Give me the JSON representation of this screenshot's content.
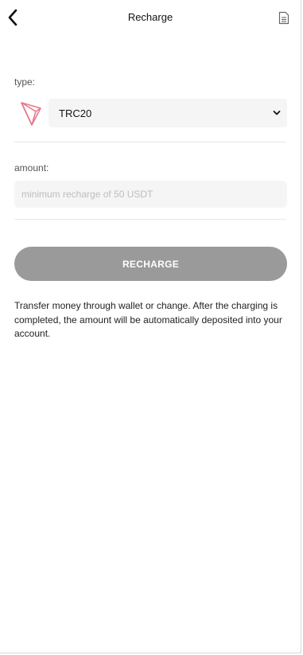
{
  "header": {
    "title": "Recharge"
  },
  "form": {
    "type_label": "type:",
    "type_selected": "TRC20",
    "amount_label": "amount:",
    "amount_placeholder": "minimum recharge of 50 USDT",
    "amount_value": ""
  },
  "actions": {
    "recharge_label": "RECHARGE"
  },
  "info": {
    "text": "Transfer money through wallet or change. After the charging is completed, the amount will be automatically deposited into your account."
  },
  "icons": {
    "back": "chevron-left-icon",
    "records": "document-icon",
    "coin": "tron-icon",
    "dropdown": "chevron-down-icon"
  },
  "colors": {
    "button_bg": "#9a9a9a",
    "field_bg": "#f5f5f5",
    "coin_icon": "#e8778d"
  }
}
